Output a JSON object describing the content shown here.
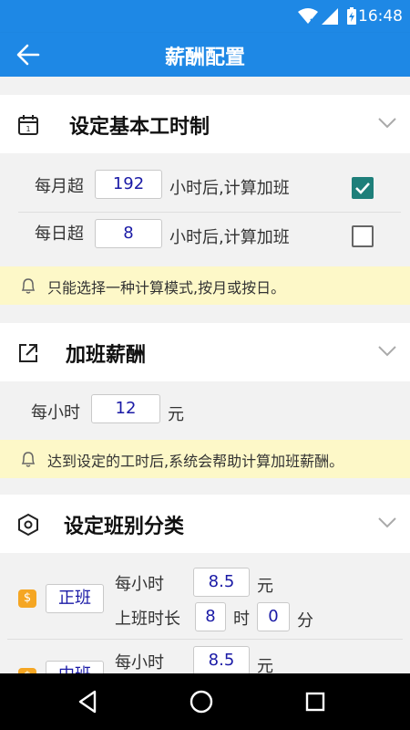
{
  "status_bar": {
    "time": "16:48"
  },
  "app_bar": {
    "title": "薪酬配置"
  },
  "section_work_hours": {
    "title": "设定基本工时制",
    "monthly": {
      "prefix": "每月超",
      "value": "192",
      "suffix": "小时后,计算加班",
      "checked": true
    },
    "daily": {
      "prefix": "每日超",
      "value": "8",
      "suffix": "小时后,计算加班",
      "checked": false
    },
    "notice": "只能选择一种计算模式,按月或按日。"
  },
  "section_overtime": {
    "title": "加班薪酬",
    "per_hour_label": "每小时",
    "per_hour_value": "12",
    "unit": "元",
    "notice": "达到设定的工时后,系统会帮助计算加班薪酬。"
  },
  "section_shifts": {
    "title": "设定班别分类",
    "shifts": [
      {
        "name": "正班",
        "per_hour_label": "每小时",
        "per_hour_value": "8.5",
        "unit": "元",
        "duration_label": "上班时长",
        "hours": "8",
        "hours_unit": "时",
        "minutes": "0",
        "minutes_unit": "分"
      },
      {
        "name": "中班",
        "per_hour_label": "每小时",
        "per_hour_value": "8.5",
        "unit": "元"
      }
    ]
  },
  "colors": {
    "primary": "#1e88e5",
    "checkbox": "#1e7f7a",
    "notice_bg": "#fdf8c8",
    "value_text": "#1a1aa6"
  }
}
